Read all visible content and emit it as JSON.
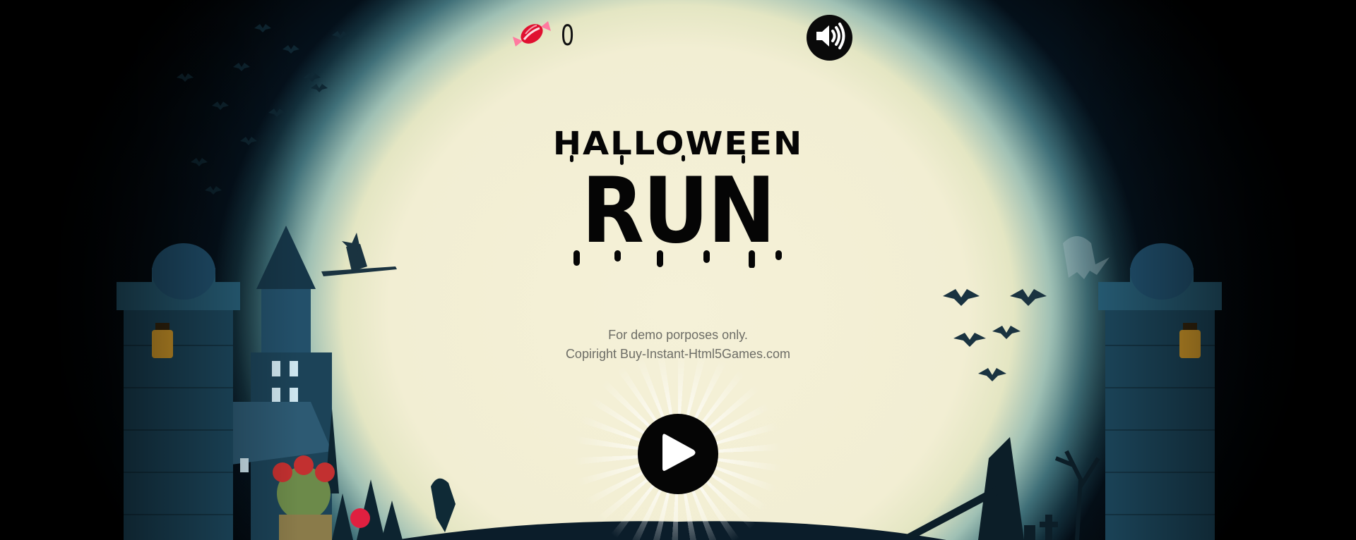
{
  "hud": {
    "candy_icon": "candy-icon",
    "candy_count": "0",
    "sound_icon": "speaker-on-icon"
  },
  "title": {
    "line1": "HALLOWEEN",
    "line2": "RUN"
  },
  "notice": {
    "line1": "For demo porposes only.",
    "line2": "Copiright Buy-Instant-Html5Games.com"
  },
  "play": {
    "icon": "play-icon"
  },
  "colors": {
    "moon": "#f2eed3",
    "sky_dark": "#061522",
    "silhouette": "#050505",
    "stone": "#1f4e66",
    "lantern": "#f0b030",
    "candy": "#e01030"
  }
}
